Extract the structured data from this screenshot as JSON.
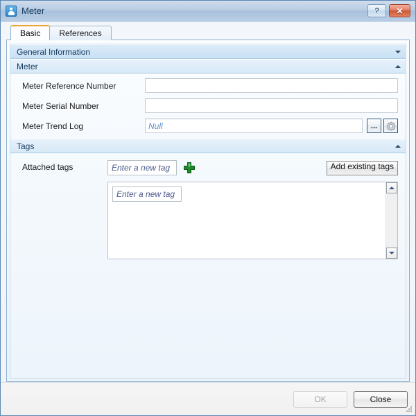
{
  "window": {
    "title": "Meter",
    "icon": "user-meter-icon",
    "help_button": "?",
    "close_button": "✕"
  },
  "tabs": [
    {
      "label": "Basic",
      "active": true
    },
    {
      "label": "References",
      "active": false
    }
  ],
  "groups": [
    {
      "label": "General Information",
      "chevron": "chevron-down-icon",
      "expanded": false
    },
    {
      "label": "Meter",
      "chevron": "chevron-up-icon",
      "expanded": true
    },
    {
      "label": "Tags",
      "chevron": "chevron-up-icon",
      "expanded": true
    }
  ],
  "meter_fields": [
    {
      "label": "Meter Reference Number",
      "value": "",
      "placeholder": ""
    },
    {
      "label": "Meter Serial Number",
      "value": "",
      "placeholder": ""
    },
    {
      "label": "Meter Trend Log",
      "value": "",
      "placeholder": "Null"
    }
  ],
  "trend_log_buttons": {
    "browse": "...",
    "browse_icon": "ellipsis-icon",
    "settings_icon": "gear-icon"
  },
  "tags": {
    "label": "Attached tags",
    "new_tag_placeholder": "Enter a new tag",
    "add_icon": "green-plus-icon",
    "add_existing_label": "Add existing tags",
    "list_new_tag_placeholder": "Enter a new tag",
    "list_items": [],
    "scroll_up_icon": "scroll-up-arrow-icon",
    "scroll_down_icon": "scroll-down-arrow-icon"
  },
  "footer": {
    "ok_label": "OK",
    "ok_enabled": false,
    "close_label": "Close",
    "resize_grip": "resize-grip-icon"
  },
  "colors": {
    "accent_tab": "#f0a32c",
    "titlebar": "#b6cbe2",
    "group_header": "#c9e0f4",
    "placeholder_blue": "#5b8fc9",
    "tag_placeholder": "#4c5a8a",
    "close_button_red": "#cf5635",
    "plus_green": "#1f8a2a"
  }
}
